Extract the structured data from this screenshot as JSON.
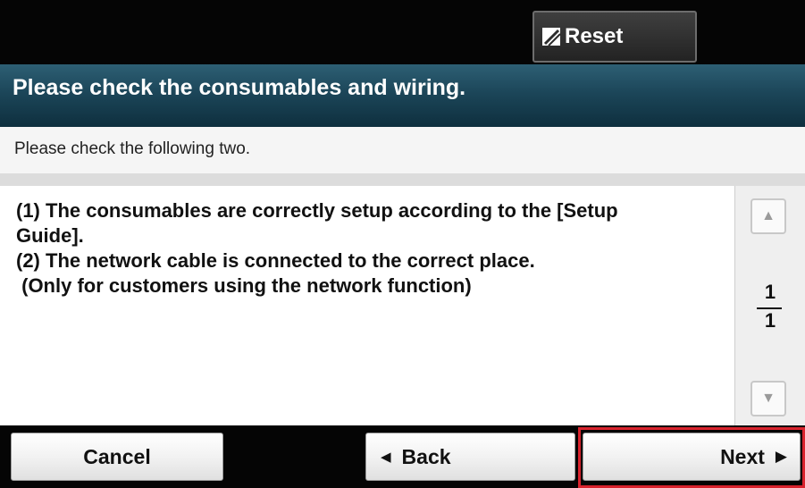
{
  "header": {
    "reset_label": "Reset",
    "reset_icon": "reset-slash-icon"
  },
  "title": "Please check the consumables and wiring.",
  "subtitle": "Please check the following two.",
  "message": {
    "lines": [
      "(1) The consumables are correctly setup according to the [Setup",
      "Guide].",
      "(2) The network cable is connected to the correct place.",
      " (Only for customers using the network function)"
    ]
  },
  "pager": {
    "current": "1",
    "total": "1",
    "up_icon": "triangle-up-icon",
    "down_icon": "triangle-down-icon"
  },
  "footer": {
    "cancel_label": "Cancel",
    "back_label": "Back",
    "next_label": "Next"
  },
  "colors": {
    "title_bar": "#1c4659",
    "highlight": "#d9232d"
  }
}
